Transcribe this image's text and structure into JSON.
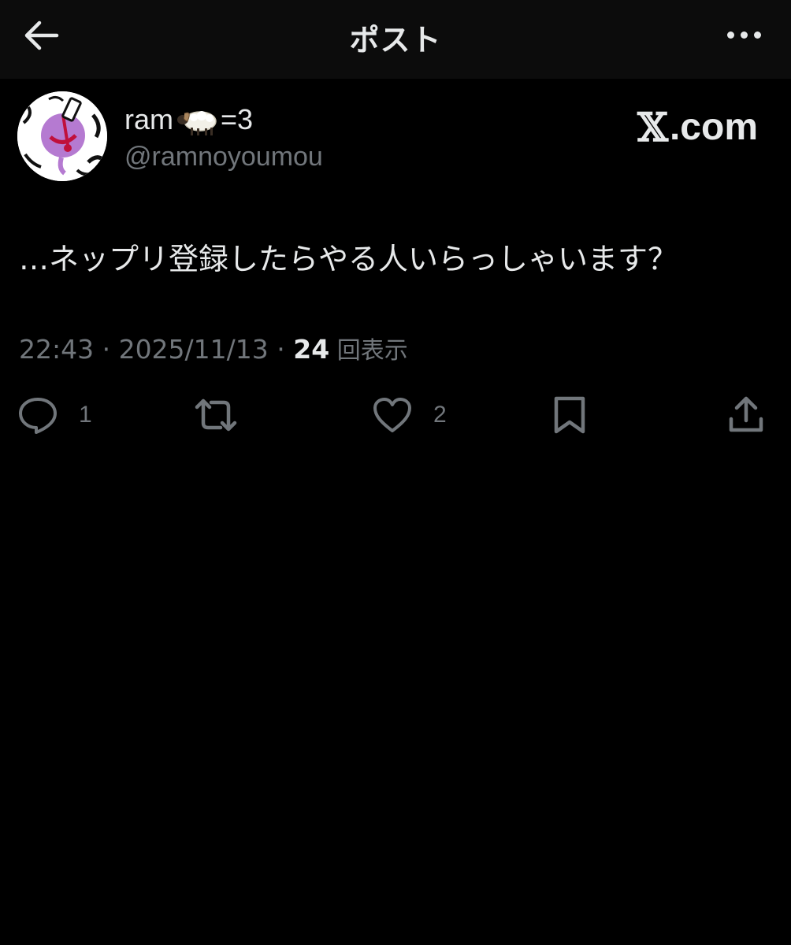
{
  "header": {
    "title": "ポスト",
    "back_icon": "arrow-left-icon",
    "more_icon": "more-horizontal-icon"
  },
  "author": {
    "display_name_prefix": "ram",
    "display_name_emoji": "ram-emoji",
    "display_name_suffix": "=3",
    "handle": "@ramnoyoumou"
  },
  "brand": {
    "x_glyph": "𝕏",
    "suffix": ".com"
  },
  "post": {
    "text": "…ネップリ登録したらやる人いらっしゃいます？"
  },
  "meta": {
    "timestamp": "22:43 · 2025/11/13 · ",
    "views_count": "24",
    "views_label": " 回表示"
  },
  "actions": {
    "reply": {
      "icon": "reply-icon",
      "count": "1"
    },
    "repost": {
      "icon": "repost-icon",
      "count": ""
    },
    "like": {
      "icon": "heart-icon",
      "count": "2"
    },
    "bookmark": {
      "icon": "bookmark-icon",
      "count": ""
    },
    "share": {
      "icon": "share-icon",
      "count": ""
    }
  },
  "colors": {
    "background": "#000000",
    "header_bg": "#0c0c0c",
    "text_primary": "#e7e9ea",
    "text_secondary": "#71767b"
  }
}
